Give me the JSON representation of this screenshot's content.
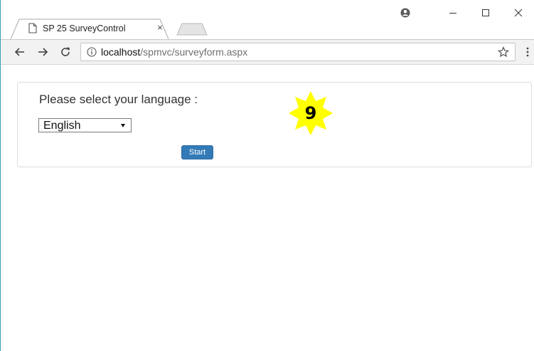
{
  "tab": {
    "title": "SP 25 SurveyControl",
    "close_glyph": "×"
  },
  "address_bar": {
    "host": "localhost",
    "path": "/spmvc/surveyform.aspx"
  },
  "survey": {
    "prompt": "Please select your language :",
    "language_selected": "English",
    "start_label": "Start"
  },
  "annotation": {
    "step_number": "9"
  },
  "icons": {
    "tab": "page-icon",
    "close": "close-icon",
    "profile": "profile-icon",
    "minimize": "minimize-icon",
    "maximize": "maximize-icon",
    "window_close": "window-close-icon",
    "back": "back-arrow-icon",
    "forward": "forward-arrow-icon",
    "reload": "reload-icon",
    "info": "info-icon",
    "bookmark": "star-icon",
    "menu": "kebab-menu-icon"
  },
  "colors": {
    "button": "#337ab7",
    "badge": "#ffff00",
    "window_border": "#3aa0b8"
  }
}
